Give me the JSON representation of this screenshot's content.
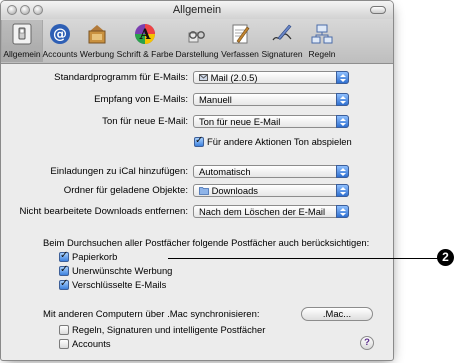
{
  "window": {
    "title": "Allgemein"
  },
  "toolbar": {
    "items": [
      {
        "label": "Allgemein",
        "icon": "general-switch-icon"
      },
      {
        "label": "Accounts",
        "icon": "at-sign-icon"
      },
      {
        "label": "Werbung",
        "icon": "junk-mail-icon"
      },
      {
        "label": "Schrift & Farbe",
        "icon": "fonts-colors-icon"
      },
      {
        "label": "Darstellung",
        "icon": "viewing-icon"
      },
      {
        "label": "Verfassen",
        "icon": "composing-icon"
      },
      {
        "label": "Signaturen",
        "icon": "signature-icon"
      },
      {
        "label": "Regeln",
        "icon": "rules-icon"
      }
    ]
  },
  "settings": {
    "default_mail_label": "Standardprogramm für E-Mails:",
    "default_mail_value": "Mail (2.0.5)",
    "check_mail_label": "Empfang von E-Mails:",
    "check_mail_value": "Manuell",
    "new_mail_sound_label": "Ton für neue E-Mail:",
    "new_mail_sound_value": "Ton für neue E-Mail",
    "other_actions_sound_label": "Für andere Aktionen Ton abspielen",
    "other_actions_sound_checked": true,
    "ical_label": "Einladungen zu iCal hinzufügen:",
    "ical_value": "Automatisch",
    "downloads_folder_label": "Ordner für geladene Objekte:",
    "downloads_folder_value": "Downloads",
    "remove_downloads_label": "Nicht bearbeitete Downloads entfernen:",
    "remove_downloads_value": "Nach dem Löschen der E-Mail"
  },
  "search": {
    "heading": "Beim Durchsuchen aller Postfächer folgende Postfächer auch berücksichtigen:",
    "options": [
      {
        "label": "Papierkorb",
        "checked": true
      },
      {
        "label": "Unerwünschte Werbung",
        "checked": true
      },
      {
        "label": "Verschlüsselte E-Mails",
        "checked": true
      }
    ]
  },
  "sync": {
    "label": "Mit anderen Computern über .Mac synchronisieren:",
    "button_label": ".Mac...",
    "options": [
      {
        "label": "Regeln, Signaturen und intelligente Postfächer",
        "checked": false
      },
      {
        "label": "Accounts",
        "checked": false
      }
    ],
    "help_label": "?"
  },
  "callout": {
    "number": "2"
  }
}
